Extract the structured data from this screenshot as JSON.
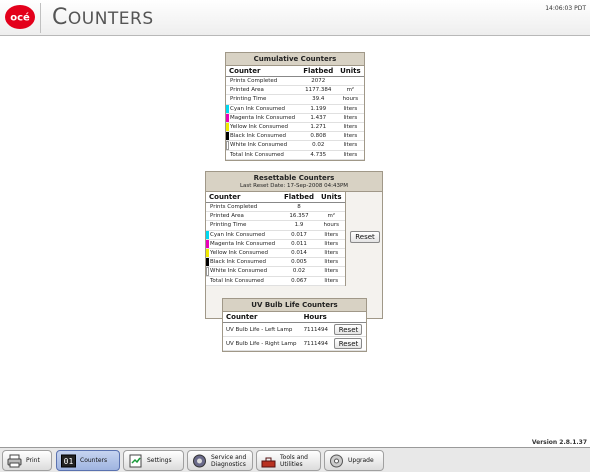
{
  "header": {
    "logo_text": "océ",
    "title_first": "C",
    "title_rest": "OUNTERS",
    "clock": "14:06:03 PDT"
  },
  "cumulative": {
    "title": "Cumulative Counters",
    "columns": [
      "Counter",
      "Flatbed",
      "Units"
    ],
    "rows": [
      {
        "name": "Prints Completed",
        "value": "2072",
        "unit": "",
        "color": ""
      },
      {
        "name": "Printed Area",
        "value": "1177.384",
        "unit": "m²",
        "color": ""
      },
      {
        "name": "Printing Time",
        "value": "39.4",
        "unit": "hours",
        "color": ""
      },
      {
        "name": "Cyan Ink Consumed",
        "value": "1.199",
        "unit": "liters",
        "color": "#00d8f0"
      },
      {
        "name": "Magenta Ink Consumed",
        "value": "1.437",
        "unit": "liters",
        "color": "#e800b8"
      },
      {
        "name": "Yellow Ink Consumed",
        "value": "1.271",
        "unit": "liters",
        "color": "#f0e800"
      },
      {
        "name": "Black Ink Consumed",
        "value": "0.808",
        "unit": "liters",
        "color": "#000000"
      },
      {
        "name": "White Ink Consumed",
        "value": "0.02",
        "unit": "liters",
        "color": "#ffffff"
      },
      {
        "name": "Total Ink Consumed",
        "value": "4.735",
        "unit": "liters",
        "color": ""
      }
    ]
  },
  "resettable": {
    "title": "Resettable Counters",
    "last_reset": "Last Reset Date: 17-Sep-2008 04:43PM",
    "columns": [
      "Counter",
      "Flatbed",
      "Units"
    ],
    "reset_label": "Reset",
    "rows": [
      {
        "name": "Prints Completed",
        "value": "8",
        "unit": "",
        "color": ""
      },
      {
        "name": "Printed Area",
        "value": "16.357",
        "unit": "m²",
        "color": ""
      },
      {
        "name": "Printing Time",
        "value": "1.9",
        "unit": "hours",
        "color": ""
      },
      {
        "name": "Cyan Ink Consumed",
        "value": "0.017",
        "unit": "liters",
        "color": "#00d8f0"
      },
      {
        "name": "Magenta Ink Consumed",
        "value": "0.011",
        "unit": "liters",
        "color": "#e800b8"
      },
      {
        "name": "Yellow Ink Consumed",
        "value": "0.014",
        "unit": "liters",
        "color": "#f0e800"
      },
      {
        "name": "Black Ink Consumed",
        "value": "0.005",
        "unit": "liters",
        "color": "#000000"
      },
      {
        "name": "White Ink Consumed",
        "value": "0.02",
        "unit": "liters",
        "color": "#ffffff"
      },
      {
        "name": "Total Ink Consumed",
        "value": "0.067",
        "unit": "liters",
        "color": ""
      }
    ]
  },
  "uvbulb": {
    "title": "UV Bulb Life Counters",
    "columns": [
      "Counter",
      "Hours"
    ],
    "reset_label": "Reset",
    "rows": [
      {
        "name": "UV Bulb Life - Left Lamp",
        "value": "7111494"
      },
      {
        "name": "UV Bulb Life - Right Lamp",
        "value": "7111494"
      }
    ]
  },
  "version": "Version 2.8.1.37",
  "tabs": [
    {
      "label": "Print",
      "icon": "print-icon",
      "active": false
    },
    {
      "label": "Counters",
      "icon": "counters-icon",
      "active": true
    },
    {
      "label": "Settings",
      "icon": "settings-icon",
      "active": false
    },
    {
      "label": "Service and\nDiagnostics",
      "icon": "service-icon",
      "active": false
    },
    {
      "label": "Tools and\nUtilities",
      "icon": "tools-icon",
      "active": false
    },
    {
      "label": "Upgrade",
      "icon": "upgrade-icon",
      "active": false
    }
  ],
  "colors": {
    "panel_header": "#d8d2c4",
    "active_tab": "#9fb4e0",
    "logo_red": "#e3001b"
  }
}
